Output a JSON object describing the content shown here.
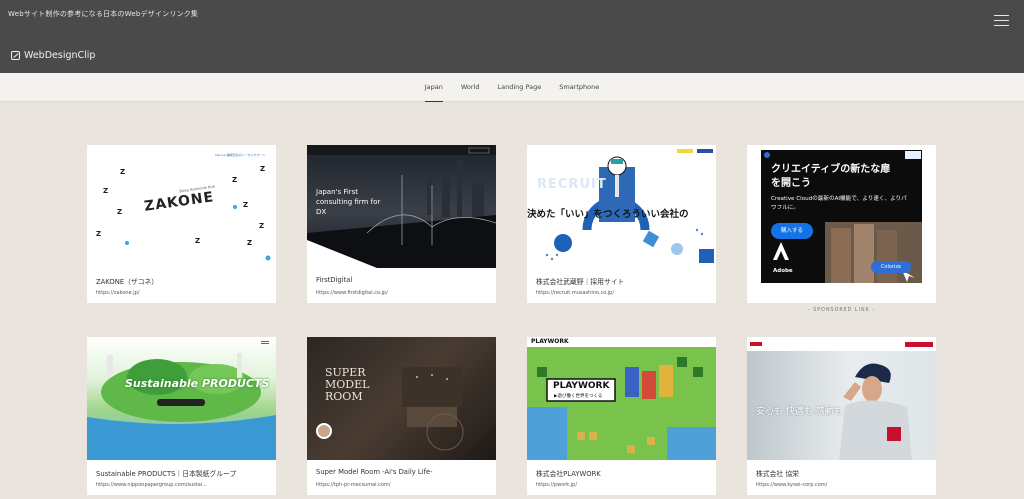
{
  "header": {
    "tagline": "Webサイト制作の参考になる日本のWebデザインリンク集",
    "logo_text": "WebDesignClip",
    "menu_icon": "hamburger-icon"
  },
  "tabs": [
    {
      "label": "Japan",
      "active": true
    },
    {
      "label": "World",
      "active": false
    },
    {
      "label": "Landing Page",
      "active": false
    },
    {
      "label": "Smartphone",
      "active": false
    }
  ],
  "cards": [
    {
      "title": "ZAKONE（ザコネ）",
      "url": "https://zakone.jp/"
    },
    {
      "title": "FirstDigital",
      "url": "https://www.firstdigital.co.jp/"
    },
    {
      "title": "株式会社武蔵野｜採用サイト",
      "url": "https://recruit.musashino.co.jp/"
    },
    {
      "title": "Sustainable PRODUCTS｜日本製紙グループ",
      "url": "https://www.nipponpapergroup.com/sustai..."
    },
    {
      "title": "Super Model Room -Ai's Daily Life-",
      "url": "https://tph-pr-mecsumai.com/"
    },
    {
      "title": "株式会社PLAYWORK",
      "url": "https://pwork.jp/"
    },
    {
      "title": "株式会社 協栄",
      "url": "https://www.kyoei-corp.com/"
    }
  ],
  "thumbs": {
    "zakone": {
      "wordmark": "ZAKONE",
      "sub": "Sleep Harmonie Hub"
    },
    "firstdigital": {
      "headline": "Japan's First consulting firm for DX"
    },
    "musashino": {
      "recruit": "RECRUIT",
      "slogan": "決めた「いい」をつくろういい会社の"
    },
    "sustainable": {
      "headline": "Sustainable PRODUCTS"
    },
    "supermodel": {
      "headline": "SUPER MODEL ROOM"
    },
    "playwork": {
      "logo": "PLAYWORK",
      "sub": "▶遊び働く世界をつくる"
    },
    "kyoei": {
      "headline": "安心も 快適も 感動も"
    }
  },
  "ad": {
    "headline": "クリエイティブの新たな扉を開こう",
    "body": "Creative Cloudの最新のAI機能で、より速く、よりパワフルに。",
    "cta": "購入する",
    "brand": "Adobe",
    "chip": "Colorize",
    "sponsored_label": "- SPONSORED LINK -"
  }
}
